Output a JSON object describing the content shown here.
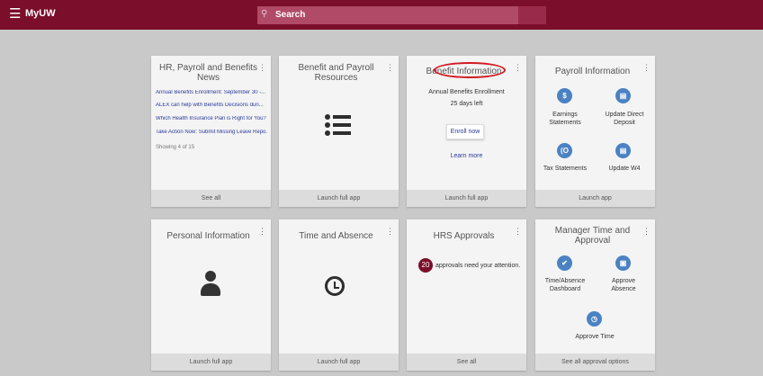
{
  "header": {
    "menu_icon": "hamburger-icon",
    "app_name": "MyUW",
    "search_placeholder": "Search",
    "search_icon": "search-icon"
  },
  "colors": {
    "brand": "#7b0e2a",
    "accent_blue": "#4a82c3",
    "link": "#2a3b9b",
    "annotation_red": "#d11a22"
  },
  "cards": {
    "hr_news": {
      "title": "HR, Payroll and Benefits News",
      "links": [
        "Annual Benefits Enrollment: September 30 -...",
        "ALEX can help with Benefits Decisions duri...",
        "Which Health Insurance Plan is Right for You?",
        "Take Action Now: Submit Missing Leave Repo..."
      ],
      "showing": "Showing 4 of 15",
      "footer": "See all"
    },
    "benefit_payroll": {
      "title": "Benefit and Payroll Resources",
      "icon": "list-icon",
      "footer": "Launch full app"
    },
    "benefit_info": {
      "title": "Benefit Information",
      "line1": "Annual Benefits Enrollment",
      "line2": "25 days left",
      "button": "Enroll now",
      "learn_more": "Learn more",
      "footer": "Launch full app"
    },
    "payroll_info": {
      "title": "Payroll Information",
      "items": [
        {
          "label": "Earnings Statements",
          "icon": "dollar-icon",
          "glyph": "$"
        },
        {
          "label": "Update Direct Deposit",
          "icon": "document-icon",
          "glyph": "▤"
        },
        {
          "label": "Tax Statements",
          "icon": "tax-icon",
          "glyph": "(O"
        },
        {
          "label": "Update W4",
          "icon": "document-icon",
          "glyph": "▤"
        }
      ],
      "footer": "Launch app"
    },
    "personal_info": {
      "title": "Personal Information",
      "icon": "person-icon",
      "footer": "Launch full app"
    },
    "time_absence": {
      "title": "Time and Absence",
      "icon": "clock-icon",
      "footer": "Launch full app"
    },
    "hrs_approvals": {
      "title": "HRS Approvals",
      "count": "20",
      "message": "approvals need your attention.",
      "footer": "See all"
    },
    "manager_time": {
      "title": "Manager Time and Approval",
      "items": [
        {
          "label": "Time/Absence Dashboard",
          "icon": "check-icon",
          "glyph": "✔"
        },
        {
          "label": "Approve Absence",
          "icon": "person-badge-icon",
          "glyph": "▣"
        },
        {
          "label": "Approve Time",
          "icon": "clock-icon",
          "glyph": "◷"
        }
      ],
      "footer": "See all approval options"
    }
  }
}
